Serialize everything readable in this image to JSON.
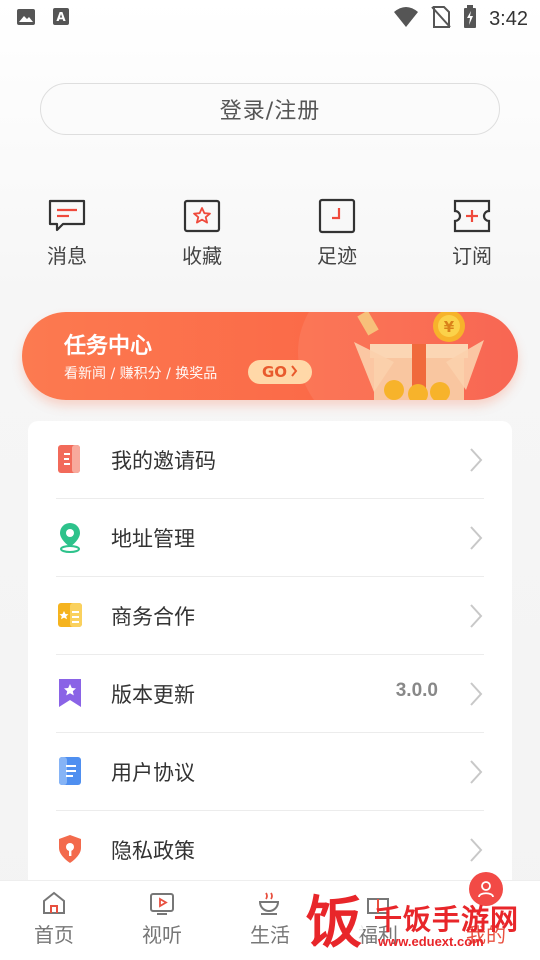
{
  "status_bar": {
    "time": "3:42",
    "icons": [
      "image-icon",
      "a-icon",
      "wifi-icon",
      "no-sim-icon",
      "battery-charging-icon"
    ]
  },
  "login": {
    "label": "登录/注册"
  },
  "quick_actions": [
    {
      "label": "消息",
      "icon": "message-icon"
    },
    {
      "label": "收藏",
      "icon": "star-icon"
    },
    {
      "label": "足迹",
      "icon": "footprint-icon"
    },
    {
      "label": "订阅",
      "icon": "subscribe-ticket-icon"
    }
  ],
  "task_banner": {
    "title": "任务中心",
    "subtitle": "看新闻 / 赚积分 / 换奖品",
    "go_label": "GO",
    "colors": {
      "start": "#fc7a50",
      "end": "#f85a45"
    }
  },
  "menu": {
    "items": [
      {
        "label": "我的邀请码",
        "icon": "invite-code-icon",
        "color": "#f26a5a"
      },
      {
        "label": "地址管理",
        "icon": "location-pin-icon",
        "color": "#2dc28b"
      },
      {
        "label": "商务合作",
        "icon": "business-card-icon",
        "color": "#f5b31e"
      },
      {
        "label": "版本更新",
        "icon": "bookmark-star-icon",
        "color": "#8a63e6",
        "value": "3.0.0"
      },
      {
        "label": "用户协议",
        "icon": "document-icon",
        "color": "#4f8ff0"
      },
      {
        "label": "隐私政策",
        "icon": "privacy-shield-icon",
        "color": "#f36a4c"
      }
    ]
  },
  "bottom_nav": {
    "tabs": [
      {
        "label": "首页",
        "icon": "home-icon"
      },
      {
        "label": "视听",
        "icon": "video-icon"
      },
      {
        "label": "生活",
        "icon": "coffee-icon"
      },
      {
        "label": "福利",
        "icon": "gift-icon"
      },
      {
        "label": "我的",
        "icon": "user-icon",
        "active": true
      }
    ]
  },
  "watermark": {
    "title": "千饭手游网",
    "url": "www.eduext.com",
    "logo_char": "饭"
  }
}
